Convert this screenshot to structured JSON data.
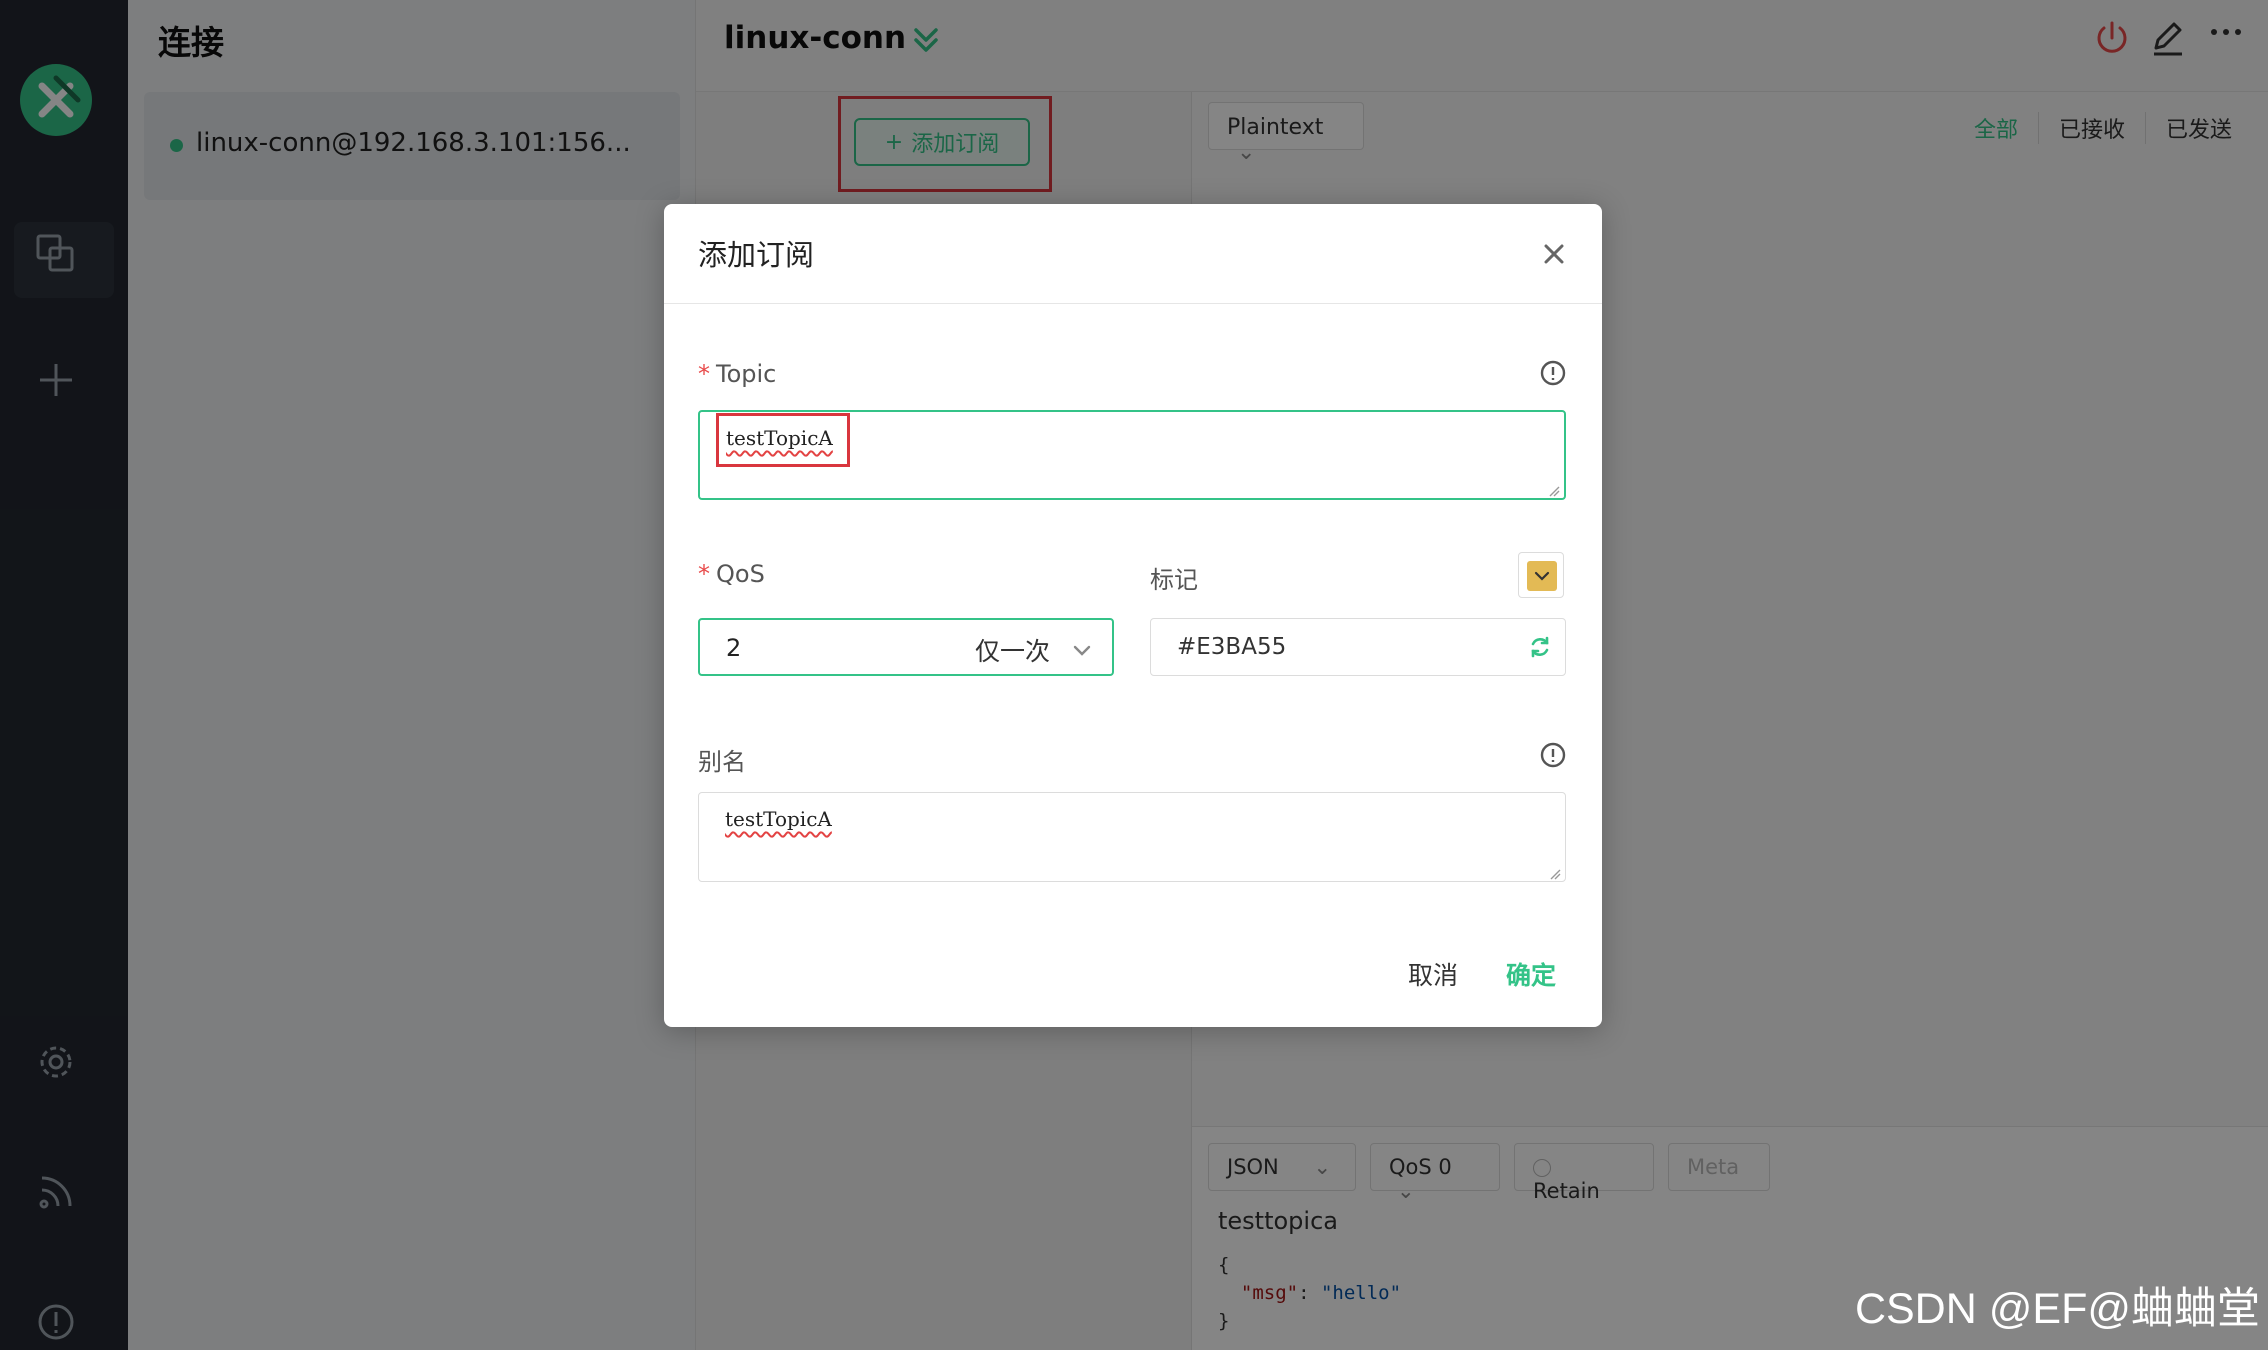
{
  "connections": {
    "title": "连接",
    "items": [
      {
        "name": "linux-conn@192.168.3.101:156...",
        "status": "connected"
      }
    ]
  },
  "topbar": {
    "title": "linux-conn"
  },
  "subscriptions": {
    "add_label": "添加订阅"
  },
  "messages": {
    "format": "Plaintext",
    "filters": [
      "全部",
      "已接收",
      "已发送"
    ]
  },
  "composer": {
    "format": "JSON",
    "qos": "QoS 0",
    "retain": "Retain",
    "meta": "Meta",
    "topic": "testtopica",
    "payload_open": "{",
    "payload_key": "\"msg\"",
    "payload_colon": ": ",
    "payload_value": "\"hello\"",
    "payload_close": "}"
  },
  "dialog": {
    "title": "添加订阅",
    "topic_label": "Topic",
    "topic_value": "testTopicA",
    "qos_label": "QoS",
    "qos_value": "2",
    "qos_desc": "仅一次",
    "color_label": "标记",
    "color_value": "#E3BA55",
    "alias_label": "别名",
    "alias_value": "testTopicA",
    "cancel": "取消",
    "confirm": "确定"
  },
  "colors": {
    "accent": "#34c388",
    "tag_color": "#E3BA55",
    "highlight": "#d9363e"
  },
  "watermark": "CSDN @EF@蛐蛐堂"
}
